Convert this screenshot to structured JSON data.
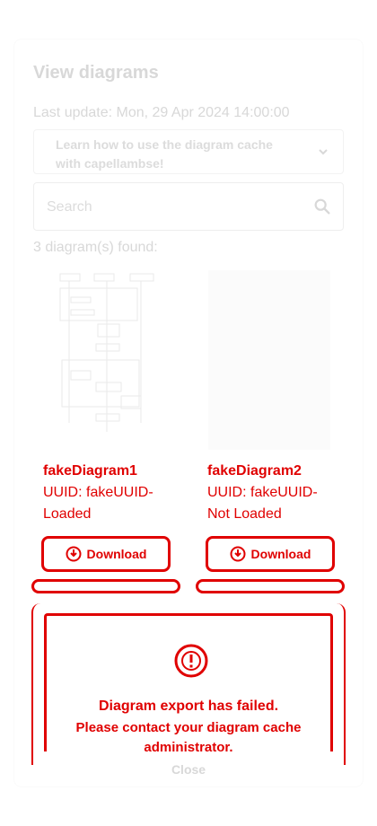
{
  "page": {
    "title": "View diagrams",
    "last_update": "Last update: Mon, 29 Apr 2024 14:00:00"
  },
  "info_accordion": {
    "label": "Learn how to use the diagram cache with capellambse!",
    "icon": "chevron-down-icon"
  },
  "search": {
    "placeholder": "Search",
    "value": "",
    "icon": "search-icon"
  },
  "results": {
    "count_text": "3 diagram(s) found:"
  },
  "diagrams": [
    {
      "name": "fakeDiagram1",
      "uuid": "UUID: fakeUUID-",
      "status": "Loaded",
      "download_label": "Download",
      "download_icon": "download-icon"
    },
    {
      "name": "fakeDiagram2",
      "uuid": "UUID: fakeUUID-",
      "status": "Not Loaded",
      "download_label": "Download",
      "download_icon": "download-icon"
    }
  ],
  "alert": {
    "icon": "error-icon",
    "title": "Diagram export has failed.",
    "message": "Please contact your diagram cache administrator."
  },
  "footer": {
    "close_label": "Close"
  },
  "colors": {
    "error": "#e00000",
    "muted_text": "#d8d8d8",
    "background": "#ffffff"
  }
}
